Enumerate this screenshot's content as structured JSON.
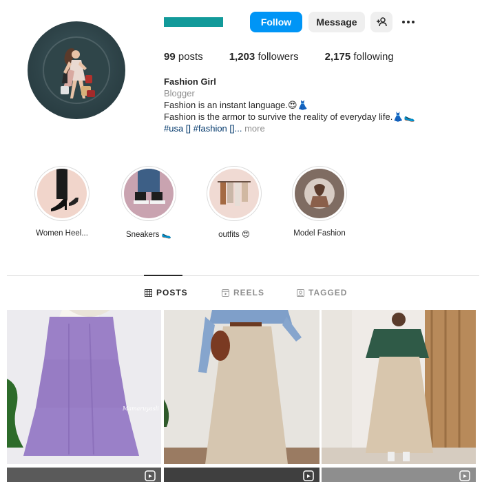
{
  "profile": {
    "buttons": {
      "follow": "Follow",
      "message": "Message"
    },
    "stats": {
      "posts_count": "99",
      "posts_label": "posts",
      "followers_count": "1,203",
      "followers_label": "followers",
      "following_count": "2,175",
      "following_label": "following"
    },
    "bio": {
      "name": "Fashion Girl",
      "category": "Blogger",
      "line1": "Fashion is an instant language.😍👗",
      "line2": "Fashion is the armor to survive the reality of everyday life.👗🥿",
      "tags": "#usa [] #fashion []...",
      "more": " more"
    }
  },
  "highlights": [
    {
      "label": "Women Heel..."
    },
    {
      "label": "Sneakers 🥿"
    },
    {
      "label": "outfits 😍"
    },
    {
      "label": "Model Fashion"
    }
  ],
  "tabs": [
    {
      "label": "POSTS",
      "icon": "grid-icon",
      "active": true
    },
    {
      "label": "REELS",
      "icon": "reels-icon",
      "active": false
    },
    {
      "label": "TAGGED",
      "icon": "tagged-icon",
      "active": false
    }
  ],
  "posts": [
    {
      "watermark": "Mamaruyasli"
    }
  ],
  "colors": {
    "accent": "#0095f6",
    "username_bar": "#129a9a",
    "link": "#00376b"
  }
}
